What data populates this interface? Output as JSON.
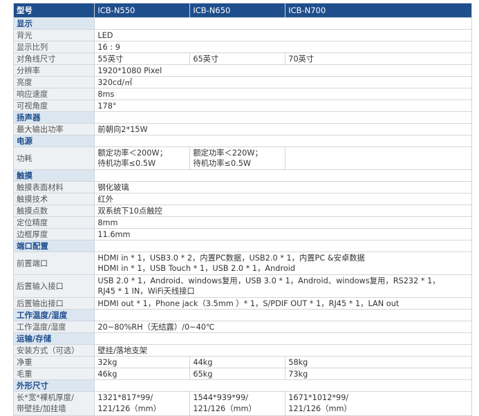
{
  "header": [
    "型号",
    "ICB-N550",
    "ICB-N650",
    "ICB-N700"
  ],
  "sections": {
    "display": "显示",
    "speaker": "扬声器",
    "power": "电源",
    "touch": "触摸",
    "ports": "端口配置",
    "temp": "工作温度/湿度",
    "transport": "运输/存储",
    "dims": "外形尺寸"
  },
  "rows": {
    "backlight": {
      "label": "背光",
      "v": "LED"
    },
    "ratio": {
      "label": "显示比列",
      "v": "16 : 9"
    },
    "diag": {
      "label": "对角线尺寸",
      "v1": "55英寸",
      "v2": "65英寸",
      "v3": "70英寸"
    },
    "res": {
      "label": "分辨率",
      "v": "1920*1080 Pixel"
    },
    "bright": {
      "label": "亮度",
      "v": "320cd/㎡"
    },
    "resp": {
      "label": "响应速度",
      "v": "8ms"
    },
    "angle": {
      "label": "可视角度",
      "v": "178°"
    },
    "out": {
      "label": "最大输出功率",
      "v": "前朝向2*15W"
    },
    "pwr": {
      "label": "功耗",
      "v1a": "额定功率＜200W；",
      "v1b": "待机功率≤0.5W",
      "v2a": "额定功率＜220W；",
      "v2b": "待机功率≤0.5W"
    },
    "surface": {
      "label": "触摸表面材料",
      "v": "钢化玻璃"
    },
    "tech": {
      "label": "触摸技术",
      "v": "红外"
    },
    "points": {
      "label": "触摸点数",
      "v": "双系统下10点触控"
    },
    "prec": {
      "label": "定位精度",
      "v": "8mm"
    },
    "bezel": {
      "label": "边框厚度",
      "v": "11.6mm"
    },
    "front": {
      "label": "前置端口",
      "a": "HDMI in * 1，USB3.0 * 2，内置PC数据，USB2.0 * 1，内置PC &安卓数据",
      "b": "HDMI in * 1，USB Touch * 1，USB 2.0 * 1，Android"
    },
    "rearin": {
      "label": "后置输入接口",
      "a": "USB 2.0 * 1，Android、windows复用，USB 3.0 * 1，Android、windows复用，RS232 * 1，",
      "b": "RJ45 * 1  IN，WiFi天线接口"
    },
    "rearout": {
      "label": "后置输出接口",
      "v": "HDMI out * 1，Phone jack（3.5mm ）* 1，S/PDIF OUT * 1，RJ45 * 1，LAN out"
    },
    "temp": {
      "label": "工作温度/湿度",
      "v": "20~80%RH（无结露）/0~40℃"
    },
    "mount": {
      "label": "安装方式（可选）",
      "v": "壁挂/落地支架"
    },
    "net": {
      "label": "净重",
      "v1": "32kg",
      "v2": "44kg",
      "v3": "58kg"
    },
    "gross": {
      "label": "毛重",
      "v1": "46kg",
      "v2": "65kg",
      "v3": "73kg"
    },
    "size": {
      "la": "长*宽*裸机厚度/",
      "lb": "带壁挂/加挂墙",
      "v1a": "1321*817*99/",
      "v1b": "121/126（mm）",
      "v2a": "1544*939*99/",
      "v2b": "121/126（mm）",
      "v3a": "1671*1012*99/",
      "v3b": "121/126（mm）"
    }
  }
}
